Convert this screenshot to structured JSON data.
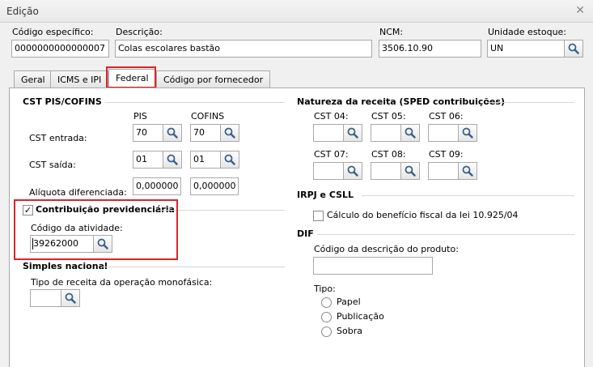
{
  "window": {
    "title": "Edição"
  },
  "header": {
    "codigo_label": "Código específico:",
    "codigo_value": "0000000000000007",
    "descricao_label": "Descrição:",
    "descricao_value": "Colas escolares bastão",
    "ncm_label": "NCM:",
    "ncm_value": "3506.10.90",
    "unidade_label": "Unidade estoque:",
    "unidade_value": "UN"
  },
  "tabs": [
    {
      "label": "Geral"
    },
    {
      "label": "ICMS e IPI"
    },
    {
      "label": "Federal"
    },
    {
      "label": "Código por fornecedor"
    }
  ],
  "cst": {
    "section": "CST PIS/COFINS",
    "pis_header": "PIS",
    "cofins_header": "COFINS",
    "entrada_label": "CST entrada:",
    "entrada_pis": "70",
    "entrada_cofins": "70",
    "saida_label": "CST saída:",
    "saida_pis": "01",
    "saida_cofins": "01",
    "aliquota_label": "Alíquota diferenciada:",
    "aliquota_pis": "0,000000",
    "aliquota_cofins": "0,000000"
  },
  "contribuicao": {
    "checkbox_label": "Contribuição previdenciária",
    "checked_glyph": "✓",
    "codigo_label": "Código da atividade:",
    "codigo_value": "39262000"
  },
  "simples": {
    "section": "Simples nacional",
    "tipo_label": "Tipo de receita da operação monofásica:",
    "tipo_value": ""
  },
  "natureza": {
    "section": "Natureza da receita (SPED contribuições)",
    "cst04": "CST 04:",
    "cst05": "CST 05:",
    "cst06": "CST 06:",
    "cst07": "CST 07:",
    "cst08": "CST 08:",
    "cst09": "CST 09:"
  },
  "irpj": {
    "section": "IRPJ e CSLL",
    "checkbox_label": "Cálculo do benefício fiscal da lei 10.925/04"
  },
  "dif": {
    "section": "DIF",
    "codigo_label": "Código da descrição do produto:",
    "codigo_value": "",
    "tipo_label": "Tipo:",
    "options": [
      "Papel",
      "Publicação",
      "Sobra"
    ]
  },
  "colors": {
    "highlight": "#d9252a",
    "border": "#a9a9a9",
    "background": "#f0f0f0"
  },
  "icons": {
    "search": "magnifier-icon",
    "close": "close-icon"
  }
}
